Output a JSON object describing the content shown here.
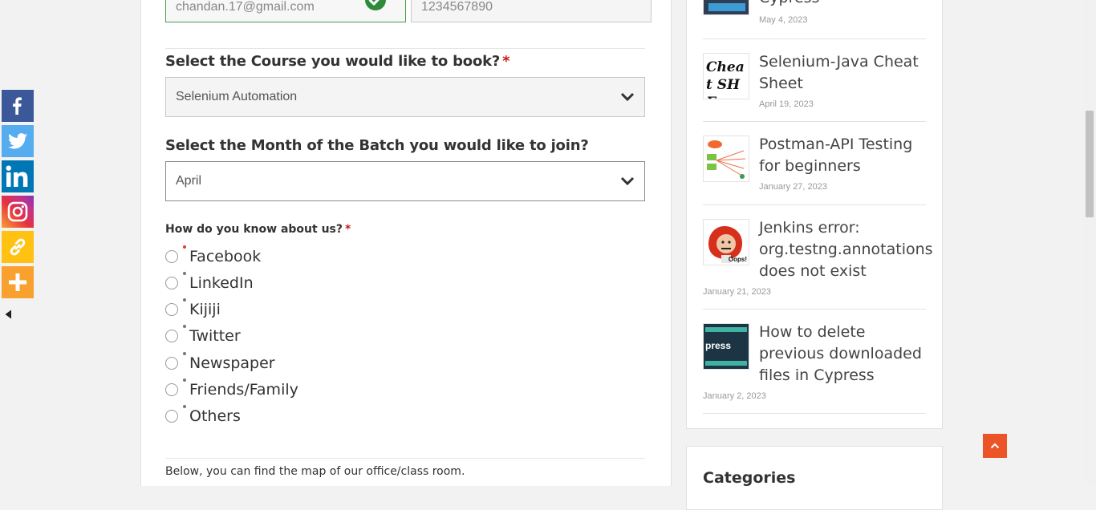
{
  "share": {
    "items": [
      {
        "name": "facebook",
        "color": "#3b5998",
        "icon": "facebook-icon"
      },
      {
        "name": "twitter",
        "color": "#55acee",
        "icon": "twitter-icon"
      },
      {
        "name": "linkedin",
        "color": "#0077b5",
        "icon": "linkedin-icon"
      },
      {
        "name": "instagram",
        "color": "#c13584",
        "icon": "instagram-icon"
      },
      {
        "name": "copy-link",
        "color": "#ffc112",
        "icon": "link-icon"
      },
      {
        "name": "more",
        "color": "#f8a12e",
        "icon": "plus-icon"
      }
    ]
  },
  "form": {
    "email_value": "chandan.17@gmail.com",
    "phone_value": "1234567890",
    "course_label": "Select the Course you would like to book?",
    "course_required": "*",
    "course_selected": "Selenium Automation",
    "month_label": "Select the Month of the Batch you would like to join?",
    "month_selected": "April",
    "source_label": "How do you know about us?",
    "source_required": "*",
    "source_options": [
      "Facebook",
      "LinkedIn",
      "Kijiji",
      "Twitter",
      "Newspaper",
      "Friends/Family",
      "Others"
    ],
    "map_text": "Below, you can find the map of our office/class room."
  },
  "sidebar": {
    "posts": [
      {
        "title_line": "Cypress",
        "date": "May 4, 2023"
      },
      {
        "title": "Selenium-Java Cheat Sheet",
        "date": "April 19, 2023",
        "thumb_text": "Cheat SHE"
      },
      {
        "title": "Postman-API Testing for beginners",
        "date": "January 27, 2023"
      },
      {
        "title": "Jenkins error: org.testng.annotations does not exist",
        "date": "January 21, 2023",
        "thumb_text": "Oops!"
      },
      {
        "title": "How to delete previous downloaded files in Cypress",
        "date": "January 2, 2023",
        "thumb_text": "press"
      }
    ],
    "categories_heading": "Categories"
  },
  "colors": {
    "accent": "#ec5427",
    "required": "#cc1818",
    "valid": "#4a9b4f"
  }
}
